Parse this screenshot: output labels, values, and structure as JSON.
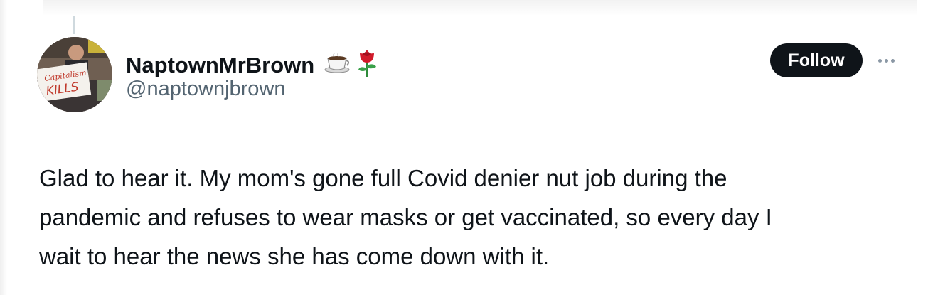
{
  "tweet": {
    "author": {
      "display_name": "NaptownMrBrown",
      "handle": "@naptownjbrown",
      "name_emojis": [
        "coffee-cup-icon",
        "rose-icon"
      ]
    },
    "follow_label": "Follow",
    "more_icon": "more-horizontal-icon",
    "text_lines": [
      "Glad to hear it. My mom's gone full Covid denier nut job during the",
      "pandemic and refuses to wear masks or get vaccinated, so every day I",
      "wait to hear the news she has come down with it."
    ],
    "avatar_sign_text": "Capitalism KILLS"
  },
  "colors": {
    "text_primary": "#0f1419",
    "text_secondary": "#536471",
    "follow_bg": "#0f1419",
    "follow_fg": "#ffffff"
  }
}
